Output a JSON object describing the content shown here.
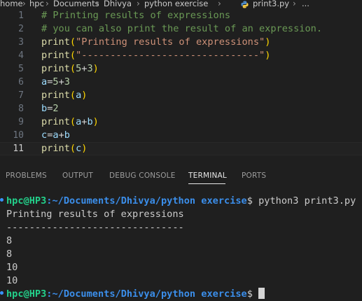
{
  "breadcrumb": {
    "items": [
      "home",
      "hpc",
      "Documents",
      "Dhivya",
      "python exercise",
      "print3.py",
      "..."
    ]
  },
  "editor": {
    "lines": [
      {
        "num": "1",
        "tokens": [
          {
            "t": "# Printing results of expressions",
            "c": "comment"
          }
        ]
      },
      {
        "num": "2",
        "tokens": [
          {
            "t": "# you can also print the result of an expression.",
            "c": "comment"
          }
        ]
      },
      {
        "num": "3",
        "tokens": [
          {
            "t": "print",
            "c": "func"
          },
          {
            "t": "(",
            "c": "paren"
          },
          {
            "t": "\"Printing results of expressions\"",
            "c": "str"
          },
          {
            "t": ")",
            "c": "paren"
          }
        ]
      },
      {
        "num": "4",
        "tokens": [
          {
            "t": "print",
            "c": "func"
          },
          {
            "t": "(",
            "c": "paren"
          },
          {
            "t": "\"-------------------------------\"",
            "c": "str"
          },
          {
            "t": ")",
            "c": "paren"
          }
        ]
      },
      {
        "num": "5",
        "tokens": [
          {
            "t": "print",
            "c": "func"
          },
          {
            "t": "(",
            "c": "paren"
          },
          {
            "t": "5",
            "c": "num"
          },
          {
            "t": "+",
            "c": "op"
          },
          {
            "t": "3",
            "c": "num"
          },
          {
            "t": ")",
            "c": "paren"
          }
        ]
      },
      {
        "num": "6",
        "tokens": [
          {
            "t": "a",
            "c": "var"
          },
          {
            "t": "=",
            "c": "op"
          },
          {
            "t": "5",
            "c": "num"
          },
          {
            "t": "+",
            "c": "op"
          },
          {
            "t": "3",
            "c": "num"
          }
        ]
      },
      {
        "num": "7",
        "tokens": [
          {
            "t": "print",
            "c": "func"
          },
          {
            "t": "(",
            "c": "paren"
          },
          {
            "t": "a",
            "c": "var"
          },
          {
            "t": ")",
            "c": "paren"
          }
        ]
      },
      {
        "num": "8",
        "tokens": [
          {
            "t": "b",
            "c": "var"
          },
          {
            "t": "=",
            "c": "op"
          },
          {
            "t": "2",
            "c": "num"
          }
        ]
      },
      {
        "num": "9",
        "tokens": [
          {
            "t": "print",
            "c": "func"
          },
          {
            "t": "(",
            "c": "paren"
          },
          {
            "t": "a",
            "c": "var"
          },
          {
            "t": "+",
            "c": "op"
          },
          {
            "t": "b",
            "c": "var"
          },
          {
            "t": ")",
            "c": "paren"
          }
        ]
      },
      {
        "num": "10",
        "tokens": [
          {
            "t": "c",
            "c": "var"
          },
          {
            "t": "=",
            "c": "op"
          },
          {
            "t": "a",
            "c": "var"
          },
          {
            "t": "+",
            "c": "op"
          },
          {
            "t": "b",
            "c": "var"
          }
        ]
      },
      {
        "num": "11",
        "tokens": [
          {
            "t": "print",
            "c": "func"
          },
          {
            "t": "(",
            "c": "paren"
          },
          {
            "t": "c",
            "c": "var"
          },
          {
            "t": ")",
            "c": "paren"
          }
        ]
      }
    ],
    "active_line": "11"
  },
  "panel": {
    "tabs": [
      "PROBLEMS",
      "OUTPUT",
      "DEBUG CONSOLE",
      "TERMINAL",
      "PORTS"
    ],
    "active_tab": "TERMINAL"
  },
  "terminal": {
    "prompt_user": "hpc@HP3",
    "prompt_path": ":~/Documents/Dhivya/python exercise",
    "prompt_symbol": "$ ",
    "command": "python3 print3.py",
    "output": [
      "Printing results of expressions",
      "-------------------------------",
      "8",
      "8",
      "10",
      "10"
    ]
  },
  "colors": {
    "comment": "#6a9955",
    "function": "#dcdcaa",
    "bracket": "#ffd700",
    "string": "#ce9178",
    "number": "#b5cea8",
    "variable": "#9cdcfe",
    "prompt_user": "#23d18b",
    "prompt_path": "#3b8eea"
  }
}
